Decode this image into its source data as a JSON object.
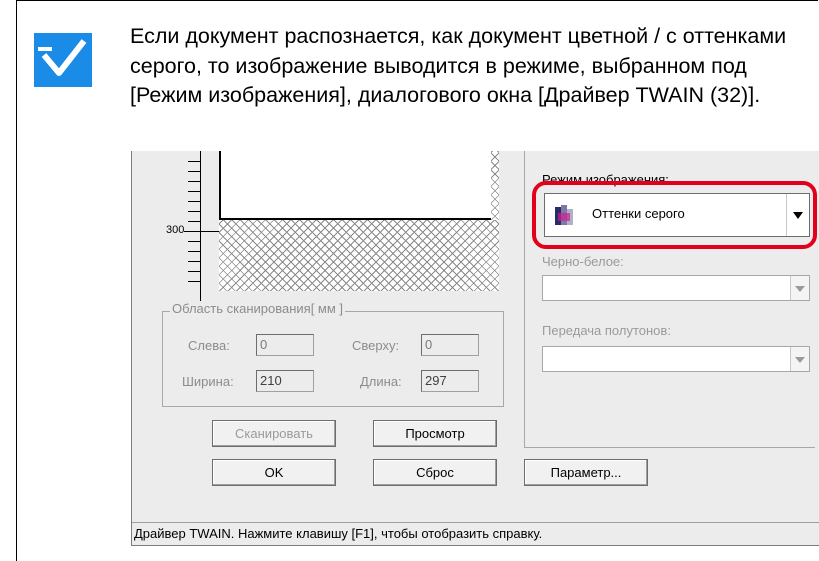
{
  "note": {
    "text": "Если документ распознается, как документ цветной / с оттенками серого, то изображение выводится в режиме, выбранном под [Режим изображения], диалогового окна [Драйвер TWAIN (32)]."
  },
  "icons": {
    "note_icon": "checkmark-icon",
    "image_mode_icon": "grayscale-mode-icon"
  },
  "colors": {
    "accent": "#1a8be6",
    "highlight": "#e2001a"
  },
  "dialog": {
    "ruler_label": "300",
    "scan_area": {
      "title": "Область сканирования[ мм ]",
      "left_label": "Слева:",
      "left_value": "0",
      "top_label": "Сверху:",
      "top_value": "0",
      "width_label": "Ширина:",
      "width_value": "210",
      "length_label": "Длина:",
      "length_value": "297"
    },
    "image_mode": {
      "label": "Режим изображения:",
      "value": "Оттенки серого"
    },
    "bw_label": "Черно-белое:",
    "halftone_label": "Передача полутонов:",
    "buttons": {
      "scan": "Сканировать",
      "preview": "Просмотр",
      "ok": "OK",
      "reset": "Сброс",
      "params": "Параметр..."
    },
    "status": "Драйвер TWAIN. Нажмите клавишу [F1], чтобы отобразить справку."
  }
}
